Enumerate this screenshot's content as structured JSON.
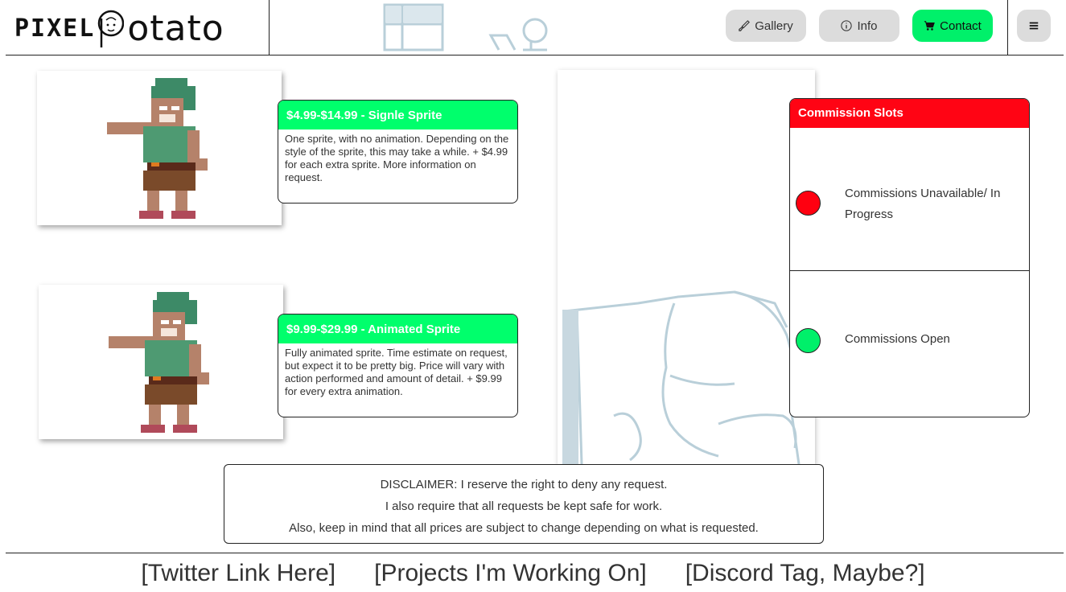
{
  "header": {
    "logo": {
      "pixel": "PIXEL",
      "potato": "otato"
    },
    "nav": {
      "gallery": "Gallery",
      "info": "Info",
      "contact": "Contact"
    },
    "colors": {
      "contact_button": "#00f06a",
      "nav_button": "#dcdcdc"
    }
  },
  "pricing": [
    {
      "title": "$4.99-$14.99 - Signle Sprite",
      "description": "One sprite, with no animation. Depending on the style of the sprite, this may take a while. + $4.99 for each extra sprite. More information on request."
    },
    {
      "title": "$9.99-$29.99 - Animated Sprite",
      "description": "Fully animated sprite. Time estimate on request, but expect it to be pretty big. Price will vary with action performed and amount of detail. + $9.99 for every extra animation."
    }
  ],
  "commission_slots": {
    "title": "Commission Slots",
    "statuses": [
      {
        "label": "Commissions Unavailable/ In Progress",
        "color": "#ff0010"
      },
      {
        "label": "Commissions Open",
        "color": "#00f06a"
      }
    ]
  },
  "disclaimer": {
    "lines": [
      "DISCLAIMER: I reserve the right to deny any request.",
      "I also require that all requests be kept safe for work.",
      "Also, keep in mind that all prices are subject to change depending on what is requested."
    ]
  },
  "footer": {
    "links": [
      "[Twitter Link Here]",
      "[Projects I'm Working On]",
      "[Discord Tag, Maybe?]"
    ]
  },
  "colors": {
    "price_header": "#00ff6c",
    "slots_header": "#ff0414"
  }
}
